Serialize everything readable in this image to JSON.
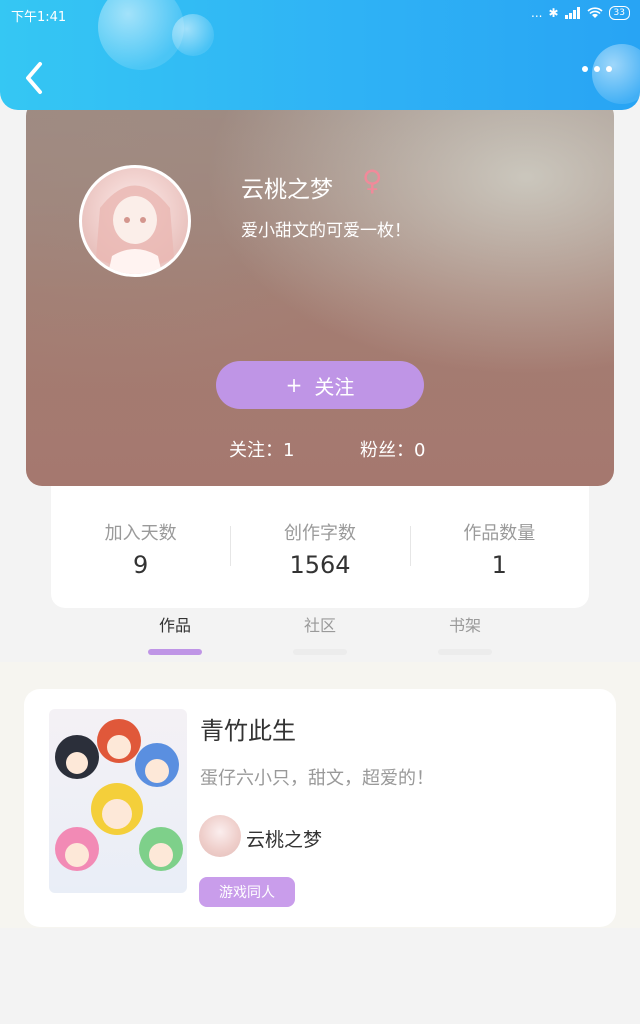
{
  "status_bar": {
    "time": "下午1:41",
    "signal_text": "...",
    "battery": "33"
  },
  "header": {
    "back_icon": "chevron-left-icon",
    "more_icon": "more-horizontal-icon"
  },
  "profile": {
    "name": "云桃之梦",
    "gender_symbol": "♀",
    "bio": "爱小甜文的可爱一枚！",
    "follow_button": {
      "plus": "+",
      "label": "关注"
    },
    "following": "关注：1",
    "fans": "粉丝：0"
  },
  "stats": [
    {
      "label": "加入天数",
      "value": "9"
    },
    {
      "label": "创作字数",
      "value": "1564"
    },
    {
      "label": "作品数量",
      "value": "1"
    }
  ],
  "tabs": [
    {
      "label": "作品",
      "active": true
    },
    {
      "label": "社区",
      "active": false
    },
    {
      "label": "书架",
      "active": false
    }
  ],
  "works": [
    {
      "title": "青竹此生",
      "description": "蛋仔六小只，甜文，超爱的！",
      "author": "云桃之梦",
      "tag": "游戏同人"
    }
  ],
  "colors": {
    "header_start": "#35c7f3",
    "header_end": "#28a4f4",
    "accent_purple": "#bf95e6",
    "gender_pink": "#f08a9a"
  }
}
